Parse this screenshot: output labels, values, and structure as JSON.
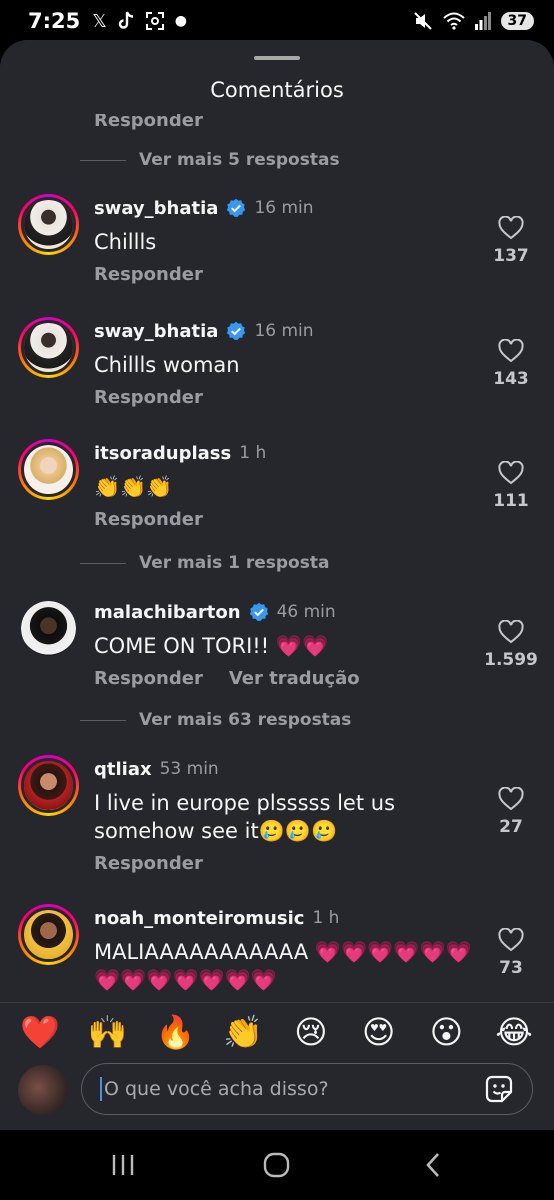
{
  "status": {
    "time": "7:25",
    "battery": "37",
    "left_icons": [
      "x-icon",
      "tiktok-icon",
      "screenshot-icon",
      "dot-icon"
    ],
    "right_icons": [
      "mute-icon",
      "wifi-icon",
      "signal-icon",
      "battery-icon"
    ]
  },
  "sheet": {
    "title": "Comentários",
    "clipped_text": "Responder"
  },
  "more_replies": [
    "Ver mais 5 respostas",
    "Ver mais 1 resposta",
    "Ver mais 63 respostas"
  ],
  "comments": [
    {
      "user": "sway_bhatia",
      "verified": true,
      "time": "16 min",
      "text": "Chillls",
      "actions": [
        "Responder"
      ],
      "likes": "137"
    },
    {
      "user": "sway_bhatia",
      "verified": true,
      "time": "16 min",
      "text": "Chillls woman",
      "actions": [
        "Responder"
      ],
      "likes": "143"
    },
    {
      "user": "itsoraduplass",
      "verified": false,
      "time": "1 h",
      "text": "👏👏👏",
      "actions": [
        "Responder"
      ],
      "likes": "111"
    },
    {
      "user": "malachibarton",
      "verified": true,
      "time": "46 min",
      "text": "COME ON TORI!! 💗💗",
      "actions": [
        "Responder",
        "Ver tradução"
      ],
      "likes": "1.599"
    },
    {
      "user": "qtliax",
      "verified": false,
      "time": "53 min",
      "text": "I live in europe plsssss let us somehow see it🥲🥲🥲",
      "actions": [
        "Responder"
      ],
      "likes": "27"
    },
    {
      "user": "noah_monteiromusic",
      "verified": false,
      "time": "1 h",
      "text": "MALIAAAAAAAAAAA 💗💗💗💗💗💗💗💗💗💗💗💗💗",
      "actions": [],
      "likes": "73"
    }
  ],
  "reactions": [
    "❤️",
    "🙌",
    "🔥",
    "👏",
    "😢",
    "😍",
    "😮",
    "😂"
  ],
  "input": {
    "placeholder": "O que você acha disso?"
  },
  "nav": [
    "recents-icon",
    "home-icon",
    "back-icon"
  ],
  "colors": {
    "sheet_bg": "#25272d",
    "text_secondary": "#9a9ca1",
    "verified_blue": "#3897f0",
    "caret_blue": "#4a90e2"
  }
}
